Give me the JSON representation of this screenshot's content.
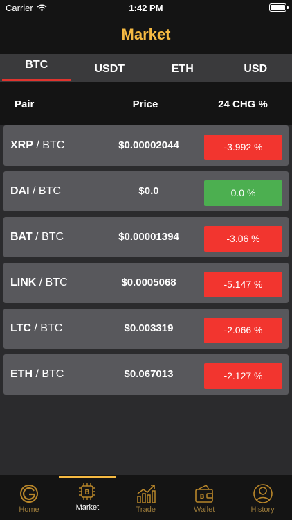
{
  "status_bar": {
    "carrier": "Carrier",
    "time": "1:42 PM"
  },
  "header": {
    "title": "Market"
  },
  "tabs": [
    {
      "label": "BTC",
      "active": true
    },
    {
      "label": "USDT",
      "active": false
    },
    {
      "label": "ETH",
      "active": false
    },
    {
      "label": "USD",
      "active": false
    }
  ],
  "columns": {
    "pair": "Pair",
    "price": "Price",
    "change": "24 CHG %"
  },
  "rows": [
    {
      "base": "XRP",
      "quote": "/ BTC",
      "price": "$0.00002044",
      "change": "-3.992 %",
      "direction": "down"
    },
    {
      "base": "DAI",
      "quote": "/ BTC",
      "price": "$0.0",
      "change": "0.0 %",
      "direction": "up"
    },
    {
      "base": "BAT",
      "quote": "/ BTC",
      "price": "$0.00001394",
      "change": "-3.06 %",
      "direction": "down"
    },
    {
      "base": "LINK",
      "quote": "/ BTC",
      "price": "$0.0005068",
      "change": "-5.147 %",
      "direction": "down"
    },
    {
      "base": "LTC",
      "quote": "/ BTC",
      "price": "$0.003319",
      "change": "-2.066 %",
      "direction": "down"
    },
    {
      "base": "ETH",
      "quote": "/ BTC",
      "price": "$0.067013",
      "change": "-2.127 %",
      "direction": "down"
    }
  ],
  "tabbar": [
    {
      "label": "Home",
      "icon": "home-g-icon",
      "active": false
    },
    {
      "label": "Market",
      "icon": "bitcoin-chip-icon",
      "active": true
    },
    {
      "label": "Trade",
      "icon": "trade-chart-icon",
      "active": false
    },
    {
      "label": "Wallet",
      "icon": "wallet-icon",
      "active": false
    },
    {
      "label": "History",
      "icon": "history-user-icon",
      "active": false
    }
  ],
  "colors": {
    "accent": "#f5b942",
    "negative": "#f2352f",
    "positive": "#4caf50",
    "tab_underline": "#e0342e"
  }
}
